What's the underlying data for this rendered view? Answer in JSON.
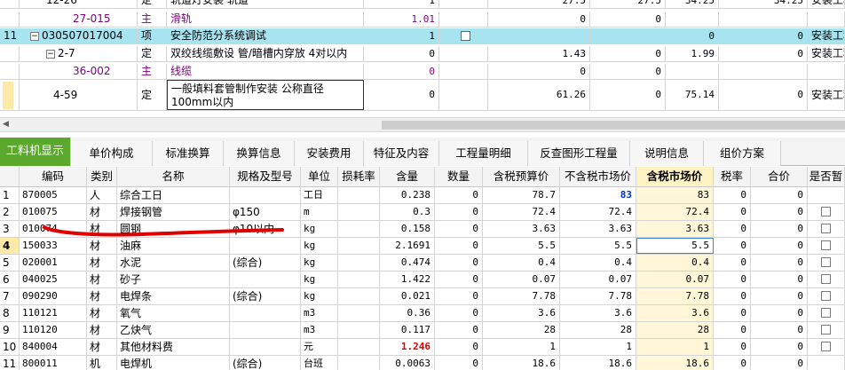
{
  "top_rows": [
    {
      "rownum": "",
      "code": "12-26",
      "type": "定",
      "name": "轨道灯安装 轨道",
      "qty": "1",
      "v1": "27.5",
      "v2": "27.5",
      "v3": "34.25",
      "v4": "34.25",
      "speciality": "安装工程",
      "kind": "sub"
    },
    {
      "rownum": "",
      "code": "27-015",
      "type": "主",
      "name": "滑轨",
      "qty": "1.01",
      "v1": "0",
      "v2": "0",
      "v3": "",
      "v4": "",
      "speciality": "",
      "kind": "main"
    },
    {
      "rownum": "11",
      "code": "030507017004",
      "type": "项",
      "name": "安全防范分系统调试",
      "qty": "1",
      "v1": "",
      "v2": "",
      "v3": "0",
      "v4": "0",
      "speciality": "安装工程",
      "kind": "item",
      "selected": true
    },
    {
      "rownum": "",
      "code": "2-7",
      "type": "定",
      "name": "双绞线缆敷设 管/暗槽内穿放 4对以内",
      "qty": "0",
      "v1": "1.43",
      "v2": "0",
      "v3": "1.99",
      "v4": "0",
      "speciality": "安装工程",
      "kind": "sub"
    },
    {
      "rownum": "",
      "code": "36-002",
      "type": "主",
      "name": "线缆",
      "qty": "0",
      "v1": "0",
      "v2": "0",
      "v3": "",
      "v4": "",
      "speciality": "",
      "kind": "main"
    },
    {
      "rownum": "",
      "code": "4-59",
      "type": "定",
      "name": "一般填料套管制作安装 公称直径100mm以内",
      "qty": "0",
      "v1": "61.26",
      "v2": "0",
      "v3": "75.14",
      "v4": "0",
      "speciality": "安装工程",
      "kind": "sub2"
    }
  ],
  "tabs": [
    "工料机显示",
    "单价构成",
    "标准换算",
    "换算信息",
    "安装费用",
    "特征及内容",
    "工程量明细",
    "反查图形工程量",
    "说明信息",
    "组价方案"
  ],
  "columns": [
    "编码",
    "类别",
    "名称",
    "规格及型号",
    "单位",
    "损耗率",
    "含量",
    "数量",
    "含税预算价",
    "不含税市场价",
    "含税市场价",
    "税率",
    "合价",
    "是否暂"
  ],
  "rows": [
    {
      "n": "1",
      "code": "870005",
      "cat": "人",
      "name": "综合工日",
      "spec": "",
      "unit": "工日",
      "loss": "",
      "content": "0.238",
      "qty": "0",
      "budget": "78.7",
      "market_ex": "83",
      "market_in": "83",
      "tax": "0",
      "total": "0",
      "chk": false
    },
    {
      "n": "2",
      "code": "010075",
      "cat": "材",
      "name": "焊接钢管",
      "spec": "φ150",
      "unit": "m",
      "loss": "",
      "content": "0.3",
      "qty": "0",
      "budget": "72.4",
      "market_ex": "72.4",
      "market_in": "72.4",
      "tax": "0",
      "total": "0",
      "chk": true
    },
    {
      "n": "3",
      "code": "010074",
      "cat": "材",
      "name": "圆钢",
      "spec": "φ10以内",
      "unit": "kg",
      "loss": "",
      "content": "0.158",
      "qty": "0",
      "budget": "3.63",
      "market_ex": "3.63",
      "market_in": "3.63",
      "tax": "0",
      "total": "0",
      "chk": true
    },
    {
      "n": "4",
      "code": "150033",
      "cat": "材",
      "name": "油麻",
      "spec": "",
      "unit": "kg",
      "loss": "",
      "content": "2.1691",
      "qty": "0",
      "budget": "5.5",
      "market_ex": "5.5",
      "market_in": "5.5",
      "tax": "0",
      "total": "0",
      "chk": true
    },
    {
      "n": "5",
      "code": "020001",
      "cat": "材",
      "name": "水泥",
      "spec": "(综合)",
      "unit": "kg",
      "loss": "",
      "content": "0.474",
      "qty": "0",
      "budget": "0.4",
      "market_ex": "0.4",
      "market_in": "0.4",
      "tax": "0",
      "total": "0",
      "chk": true
    },
    {
      "n": "6",
      "code": "040025",
      "cat": "材",
      "name": "砂子",
      "spec": "",
      "unit": "kg",
      "loss": "",
      "content": "1.422",
      "qty": "0",
      "budget": "0.07",
      "market_ex": "0.07",
      "market_in": "0.07",
      "tax": "0",
      "total": "0",
      "chk": true
    },
    {
      "n": "7",
      "code": "090290",
      "cat": "材",
      "name": "电焊条",
      "spec": "(综合)",
      "unit": "kg",
      "loss": "",
      "content": "0.021",
      "qty": "0",
      "budget": "7.78",
      "market_ex": "7.78",
      "market_in": "7.78",
      "tax": "0",
      "total": "0",
      "chk": true
    },
    {
      "n": "8",
      "code": "110121",
      "cat": "材",
      "name": "氧气",
      "spec": "",
      "unit": "m3",
      "loss": "",
      "content": "0.36",
      "qty": "0",
      "budget": "3.6",
      "market_ex": "3.6",
      "market_in": "3.6",
      "tax": "0",
      "total": "0",
      "chk": true
    },
    {
      "n": "9",
      "code": "110120",
      "cat": "材",
      "name": "乙炔气",
      "spec": "",
      "unit": "m3",
      "loss": "",
      "content": "0.117",
      "qty": "0",
      "budget": "28",
      "market_ex": "28",
      "market_in": "28",
      "tax": "0",
      "total": "0",
      "chk": true
    },
    {
      "n": "10",
      "code": "840004",
      "cat": "材",
      "name": "其他材料费",
      "spec": "",
      "unit": "元",
      "loss": "",
      "content": "1.246",
      "qty": "0",
      "budget": "1",
      "market_ex": "1",
      "market_in": "1",
      "tax": "0",
      "total": "0",
      "chk": true
    },
    {
      "n": "11",
      "code": "800011",
      "cat": "机",
      "name": "电焊机",
      "spec": "(综合)",
      "unit": "台班",
      "loss": "",
      "content": "0.0063",
      "qty": "0",
      "budget": "18.6",
      "market_ex": "18.6",
      "market_in": "18.6",
      "tax": "0",
      "total": "0",
      "chk": false
    }
  ],
  "colors": {
    "tab_active": "#5aa82c",
    "selected_row": "#a8e4f0",
    "header_highlight": "#fff3c4",
    "annotation": "#e00000"
  }
}
